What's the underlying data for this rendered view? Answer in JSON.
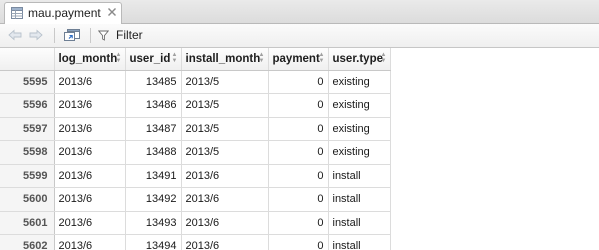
{
  "tab": {
    "title": "mau.payment",
    "icon": "data-table-icon",
    "close_icon": "close-icon"
  },
  "toolbar": {
    "back_icon": "arrow-left-icon",
    "forward_icon": "arrow-right-icon",
    "popout_icon": "popout-window-icon",
    "filter_icon": "funnel-icon",
    "filter_label": "Filter"
  },
  "table": {
    "columns": [
      "",
      "log_month",
      "user_id",
      "install_month",
      "payment",
      "user.type"
    ],
    "rows": [
      {
        "rowname": "5595",
        "log_month": "2013/6",
        "user_id": "13485",
        "install_month": "2013/5",
        "payment": "0",
        "user_type": "existing"
      },
      {
        "rowname": "5596",
        "log_month": "2013/6",
        "user_id": "13486",
        "install_month": "2013/5",
        "payment": "0",
        "user_type": "existing"
      },
      {
        "rowname": "5597",
        "log_month": "2013/6",
        "user_id": "13487",
        "install_month": "2013/5",
        "payment": "0",
        "user_type": "existing"
      },
      {
        "rowname": "5598",
        "log_month": "2013/6",
        "user_id": "13488",
        "install_month": "2013/5",
        "payment": "0",
        "user_type": "existing"
      },
      {
        "rowname": "5599",
        "log_month": "2013/6",
        "user_id": "13491",
        "install_month": "2013/6",
        "payment": "0",
        "user_type": "install"
      },
      {
        "rowname": "5600",
        "log_month": "2013/6",
        "user_id": "13492",
        "install_month": "2013/6",
        "payment": "0",
        "user_type": "install"
      },
      {
        "rowname": "5601",
        "log_month": "2013/6",
        "user_id": "13493",
        "install_month": "2013/6",
        "payment": "0",
        "user_type": "install"
      },
      {
        "rowname": "5602",
        "log_month": "2013/6",
        "user_id": "13494",
        "install_month": "2013/6",
        "payment": "0",
        "user_type": "install"
      }
    ]
  }
}
